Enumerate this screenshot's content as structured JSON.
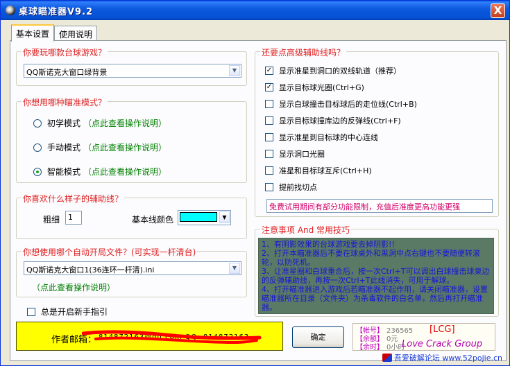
{
  "window": {
    "title": "桌球瞄准器V9.2",
    "close_glyph": "X"
  },
  "tabs": [
    {
      "label": "基本设置",
      "active": true
    },
    {
      "label": "使用说明",
      "active": false
    }
  ],
  "game_group": {
    "legend": "你要玩哪款台球游戏？",
    "selected": "QQ斯诺克大窗口绿背景"
  },
  "mode_group": {
    "legend": "你想用哪种瞄准模式？",
    "options": [
      {
        "label": "初学模式",
        "link": "（点此查看操作说明）",
        "checked": false
      },
      {
        "label": "手动模式",
        "link": "（点此查看操作说明）",
        "checked": false
      },
      {
        "label": "智能模式",
        "link": "（点此查看操作说明）",
        "checked": true
      }
    ]
  },
  "line_group": {
    "legend": "你喜欢什么样子的辅助线？",
    "thickness_label": "粗细",
    "thickness_value": "1",
    "color_label": "基本线颜色",
    "color_value": "#00ffff"
  },
  "auto_file_group": {
    "legend": "你想使用哪个自动开局文件？(可实现一杆清台)",
    "selected": "QQ斯诺克大窗口1(36连环一杆清).ini",
    "link": "（点此查看操作说明）"
  },
  "newbie_guide": {
    "label": "总是开启新手指引",
    "checked": false
  },
  "advanced_group": {
    "legend": "还要点高级辅助线吗？",
    "options": [
      {
        "label": "显示准星到洞口的双线轨道（推荐）",
        "checked": true
      },
      {
        "label": "显示目标球光圈(Ctrl+G)",
        "checked": true
      },
      {
        "label": "显示白球撞击目标球后的走位线(Ctrl+B)",
        "checked": false
      },
      {
        "label": "显示目标球撞库边的反弹线(Ctrl+F)",
        "checked": false
      },
      {
        "label": "显示准星到目标球的中心连线",
        "checked": false
      },
      {
        "label": "显示洞口光圈",
        "checked": false
      },
      {
        "label": "准星和目标球互斥(Ctrl+H)",
        "checked": false
      },
      {
        "label": "提前找切点",
        "checked": false
      }
    ],
    "notice": "免费试用期间有部分功能限制，充值后准度更高功能更强"
  },
  "tips_group": {
    "legend": "注意事项 And 常用技巧",
    "lines": [
      "1、有阴影效果的台球游戏要去掉阴影!!",
      "2、打开本瞄准器后不要在球桌外和黑洞中点右键也不要随便转滚轮，以防死机。",
      "3、让准星圈和白球重合后，按一次Ctrl+T可以调出白球撞击球臬边的反弹辅助线，再按一次Ctrl+T此线消失，可用于解球。",
      "4、打开瞄准器进入游戏后若瞄准器不起作用，请关闭瞄准器，设置瞄准器所在目录（文件夹）为杀毒软件的白名单，然后再打开瞄准器。"
    ]
  },
  "author": {
    "label": "作者邮箱：",
    "email": "814872163@qq.com  QQ: 814872163"
  },
  "ok_button": {
    "label": "确定"
  },
  "account": {
    "rows": [
      {
        "key": "【帐号】",
        "value": "236565"
      },
      {
        "key": "【余额】",
        "value": "0元"
      },
      {
        "key": "【余时】",
        "value": "0小时"
      }
    ],
    "lcg": "[LCG]",
    "crack": "Love Crack Group"
  },
  "watermark": {
    "text": "吾爱破解论坛 www.52pojie.cn"
  },
  "colors": {
    "titlebar": "#0550d4",
    "legend_red": "#e02020",
    "link_green": "#008000",
    "email_bg": "#ffff00",
    "tips_bg": "#5b7a66",
    "scribble": "#ff0000"
  }
}
